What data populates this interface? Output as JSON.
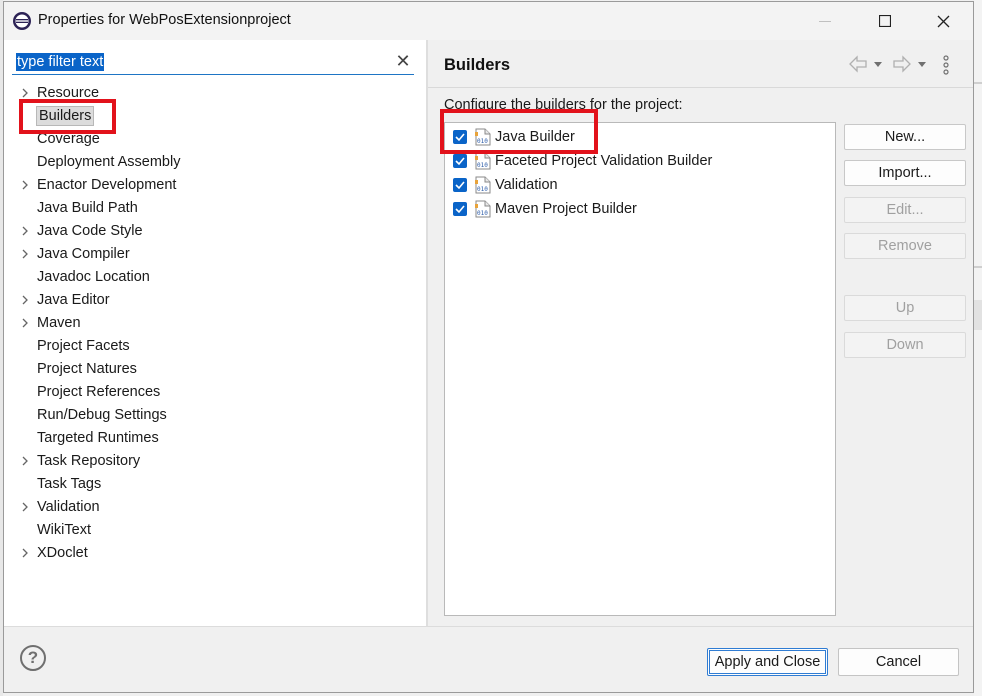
{
  "window": {
    "title": "Properties for WebPosExtensionproject",
    "minimize_glyph": "—",
    "maximize_glyph": "☐",
    "close_glyph": "✕"
  },
  "filter": {
    "value": "type filter text",
    "clear_glyph": "✕"
  },
  "tree": {
    "items": [
      {
        "label": "Resource",
        "expandable": true
      },
      {
        "label": "Builders",
        "expandable": false,
        "selected": true
      },
      {
        "label": "Coverage",
        "expandable": false
      },
      {
        "label": "Deployment Assembly",
        "expandable": false
      },
      {
        "label": "Enactor Development",
        "expandable": true
      },
      {
        "label": "Java Build Path",
        "expandable": false
      },
      {
        "label": "Java Code Style",
        "expandable": true
      },
      {
        "label": "Java Compiler",
        "expandable": true
      },
      {
        "label": "Javadoc Location",
        "expandable": false
      },
      {
        "label": "Java Editor",
        "expandable": true
      },
      {
        "label": "Maven",
        "expandable": true
      },
      {
        "label": "Project Facets",
        "expandable": false
      },
      {
        "label": "Project Natures",
        "expandable": false
      },
      {
        "label": "Project References",
        "expandable": false
      },
      {
        "label": "Run/Debug Settings",
        "expandable": false
      },
      {
        "label": "Targeted Runtimes",
        "expandable": false
      },
      {
        "label": "Task Repository",
        "expandable": true
      },
      {
        "label": "Task Tags",
        "expandable": false
      },
      {
        "label": "Validation",
        "expandable": true
      },
      {
        "label": "WikiText",
        "expandable": false
      },
      {
        "label": "XDoclet",
        "expandable": true
      }
    ]
  },
  "page": {
    "title": "Builders",
    "description": "Configure the builders for the project:",
    "builders": [
      {
        "label": "Java Builder",
        "checked": true,
        "icon": "binary-builder-icon"
      },
      {
        "label": "Faceted Project Validation Builder",
        "checked": true,
        "icon": "binary-builder-icon"
      },
      {
        "label": "Validation",
        "checked": true,
        "icon": "binary-builder-icon"
      },
      {
        "label": "Maven Project Builder",
        "checked": true,
        "icon": "binary-builder-icon"
      }
    ],
    "buttons": {
      "new": "New...",
      "import": "Import...",
      "edit": "Edit...",
      "remove": "Remove",
      "up": "Up",
      "down": "Down"
    }
  },
  "footer": {
    "help_glyph": "?",
    "apply_close": "Apply and Close",
    "cancel": "Cancel"
  },
  "colors": {
    "accent": "#0a64c8",
    "annotation": "#e2121b"
  }
}
